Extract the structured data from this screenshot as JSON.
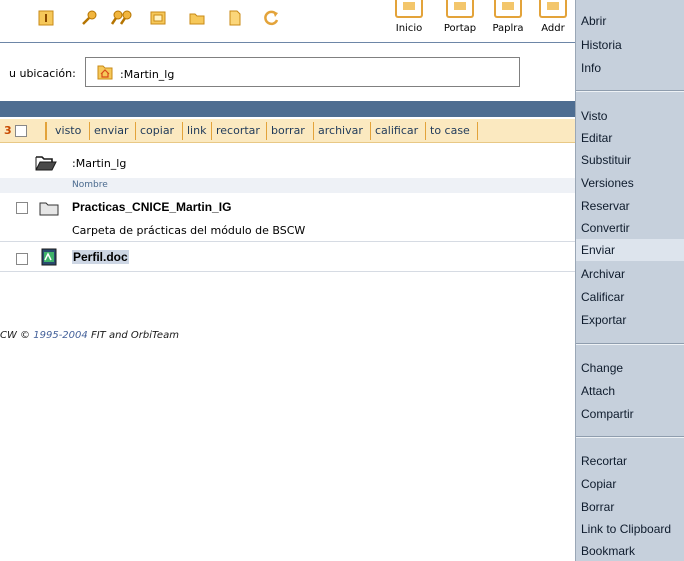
{
  "toolbar": {
    "icons": [
      "add-icon",
      "key-icon",
      "keys-icon",
      "window-icon",
      "folder-icon",
      "document-icon",
      "refresh-icon"
    ],
    "big_buttons": [
      {
        "label": "Inicio"
      },
      {
        "label": "Portap"
      },
      {
        "label": "Paplra"
      },
      {
        "label": "Addr"
      }
    ]
  },
  "location": {
    "label": "u ubicación:",
    "value": ":Martin_lg"
  },
  "actions": {
    "selected_marker": "3",
    "buttons": [
      "visto",
      "enviar",
      "copiar",
      "link",
      "recortar",
      "borrar",
      "archivar",
      "calificar",
      "to case"
    ]
  },
  "folder": {
    "current": ":Martin_lg",
    "column_header": "Nombre"
  },
  "items": [
    {
      "name": "Practicas_CNICE_Martin_IG",
      "description": "Carpeta de prácticas del módulo de BSCW",
      "type": "folder"
    },
    {
      "name": "Perfil.doc",
      "description": "",
      "type": "document"
    }
  ],
  "footer": {
    "prefix": "CW ©",
    "years": "1995-2004",
    "owner": "FIT and OrbiTeam"
  },
  "context_menu": {
    "group1": [
      "Abrir",
      "Historia",
      "Info"
    ],
    "group2": [
      "Visto",
      "Editar",
      "Substituir",
      "Versiones",
      "Reservar",
      "Convertir",
      "Enviar",
      "Archivar",
      "Calificar",
      "Exportar"
    ],
    "group3": [
      "Change",
      "Attach",
      "Compartir"
    ],
    "group4": [
      "Recortar",
      "Copiar",
      "Borrar",
      "Link to Clipboard",
      "Bookmark"
    ],
    "active_item": "Enviar",
    "colors": {
      "menu_bg": "#c6d0dc",
      "active_bg": "#dde4ed"
    }
  },
  "colors": {
    "blue_bar": "#4e6d91",
    "action_bar": "#fbe9c0",
    "accent_orange": "#e3a33a"
  }
}
